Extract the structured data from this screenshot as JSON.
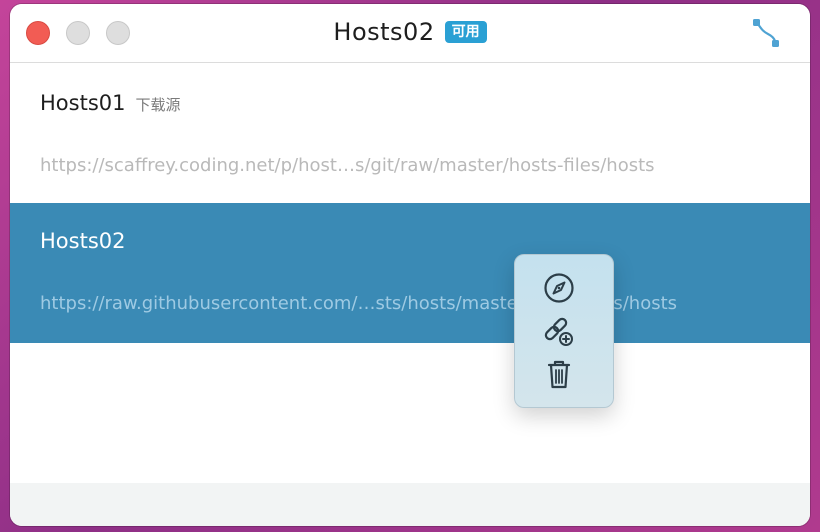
{
  "window": {
    "title": "Hosts02",
    "status_badge": "可用"
  },
  "hosts": [
    {
      "name": "Hosts01",
      "tag": "下载源",
      "url": "https://scaffrey.coding.net/p/host…s/git/raw/master/hosts-files/hosts",
      "selected": false
    },
    {
      "name": "Hosts02",
      "tag": "",
      "url": "https://raw.githubusercontent.com/…sts/hosts/master/hosts-files/hosts",
      "selected": true
    }
  ],
  "context_menu": {
    "items": [
      {
        "icon": "compass-icon",
        "action": "open-in-browser"
      },
      {
        "icon": "add-link-icon",
        "action": "add-link"
      },
      {
        "icon": "trash-icon",
        "action": "delete"
      }
    ]
  },
  "colors": {
    "accent": "#2aa0d4",
    "selected_row": "#3a8ab5",
    "icon_blue": "#4fa3d3"
  }
}
